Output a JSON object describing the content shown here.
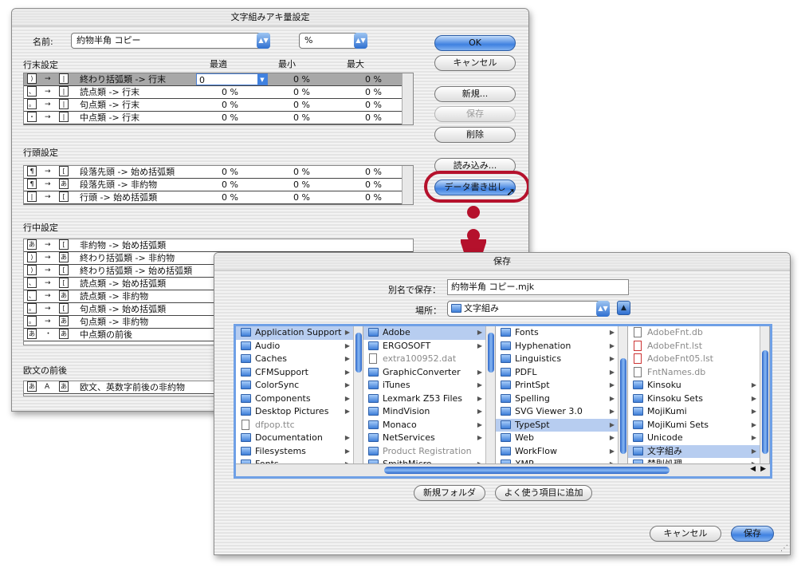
{
  "main_dialog": {
    "title": "文字組みアキ量設定",
    "name_label": "名前:",
    "name_value": "約物半角 コピー",
    "unit_value": "%",
    "ok_label": "OK",
    "cancel_label": "キャンセル",
    "new_label": "新規...",
    "save_label": "保存",
    "delete_label": "削除",
    "import_label": "読み込み...",
    "export_label": "データ書き出し",
    "col_headers": [
      "最適",
      "最小",
      "最大"
    ],
    "sections": [
      {
        "title": "行末設定",
        "rows": [
          {
            "icons": [
              "⟩",
              "→",
              "|"
            ],
            "label": "終わり括弧類 -> 行末",
            "opt": "0",
            "min": "0 %",
            "max": "0 %"
          },
          {
            "icons": [
              "、",
              "→",
              "|"
            ],
            "label": "読点類 -> 行末",
            "opt": "0 %",
            "min": "0 %",
            "max": "0 %"
          },
          {
            "icons": [
              "。",
              "→",
              "|"
            ],
            "label": "句点類 -> 行末",
            "opt": "0 %",
            "min": "0 %",
            "max": "0 %"
          },
          {
            "icons": [
              "・",
              "→",
              "|"
            ],
            "label": "中点類 -> 行末",
            "opt": "0 %",
            "min": "0 %",
            "max": "0 %"
          }
        ]
      },
      {
        "title": "行頭設定",
        "rows": [
          {
            "icons": [
              "¶",
              "→",
              "["
            ],
            "label": "段落先頭 -> 始め括弧類",
            "opt": "0 %",
            "min": "0 %",
            "max": "0 %"
          },
          {
            "icons": [
              "¶",
              "→",
              "あ"
            ],
            "label": "段落先頭 -> 非約物",
            "opt": "0 %",
            "min": "0 %",
            "max": "0 %"
          },
          {
            "icons": [
              "|",
              "→",
              "["
            ],
            "label": "行頭 -> 始め括弧類",
            "opt": "0 %",
            "min": "0 %",
            "max": "0 %"
          }
        ]
      },
      {
        "title": "行中設定",
        "rows": [
          {
            "icons": [
              "あ",
              "→",
              "["
            ],
            "label": "非約物 -> 始め括弧類"
          },
          {
            "icons": [
              "⟩",
              "→",
              "あ"
            ],
            "label": "終わり括弧類 -> 非約物"
          },
          {
            "icons": [
              "⟩",
              "→",
              "["
            ],
            "label": "終わり括弧類 -> 始め括弧類"
          },
          {
            "icons": [
              "、",
              "→",
              "["
            ],
            "label": "読点類 -> 始め括弧類"
          },
          {
            "icons": [
              "、",
              "→",
              "あ"
            ],
            "label": "読点類 -> 非約物"
          },
          {
            "icons": [
              "。",
              "→",
              "["
            ],
            "label": "句点類 -> 始め括弧類"
          },
          {
            "icons": [
              "。",
              "→",
              "あ"
            ],
            "label": "句点類 -> 非約物"
          },
          {
            "icons": [
              "あ",
              "・",
              "あ"
            ],
            "label": "中点類の前後"
          }
        ]
      },
      {
        "title": "欧文の前後",
        "rows": [
          {
            "icons": [
              "あ",
              "A",
              "あ"
            ],
            "label": "欧文、英数字前後の非約物"
          }
        ]
      }
    ]
  },
  "save_dialog": {
    "title": "保存",
    "saveas_label": "別名で保存：",
    "saveas_value": "約物半角 コピー.mjk",
    "where_label": "場所：",
    "where_value": "文字組み",
    "new_folder_label": "新規フォルダ",
    "add_fav_label": "よく使う項目に追加",
    "cancel_label": "キャンセル",
    "save_label": "保存",
    "columns": [
      [
        {
          "name": "Application Support",
          "kind": "folder",
          "sel": true,
          "arrow": true
        },
        {
          "name": "Audio",
          "kind": "folder",
          "arrow": true
        },
        {
          "name": "Caches",
          "kind": "folder",
          "arrow": true
        },
        {
          "name": "CFMSupport",
          "kind": "folder",
          "arrow": true
        },
        {
          "name": "ColorSync",
          "kind": "folder",
          "arrow": true
        },
        {
          "name": "Components",
          "kind": "folder",
          "arrow": true
        },
        {
          "name": "Desktop Pictures",
          "kind": "folder",
          "arrow": true
        },
        {
          "name": "dfpop.ttc",
          "kind": "doc",
          "dim": true
        },
        {
          "name": "Documentation",
          "kind": "folder",
          "arrow": true
        },
        {
          "name": "Filesystems",
          "kind": "folder",
          "arrow": true
        },
        {
          "name": "Fonts",
          "kind": "folder",
          "arrow": true
        }
      ],
      [
        {
          "name": "Adobe",
          "kind": "folder",
          "sel": true,
          "arrow": true
        },
        {
          "name": "ERGOSOFT",
          "kind": "folder",
          "arrow": true
        },
        {
          "name": "extra100952.dat",
          "kind": "doc",
          "dim": true
        },
        {
          "name": "GraphicConverter",
          "kind": "folder",
          "arrow": true
        },
        {
          "name": "iTunes",
          "kind": "folder",
          "arrow": true
        },
        {
          "name": "Lexmark Z53 Files",
          "kind": "folder",
          "arrow": true
        },
        {
          "name": "MindVision",
          "kind": "folder",
          "arrow": true
        },
        {
          "name": "Monaco",
          "kind": "folder",
          "arrow": true
        },
        {
          "name": "NetServices",
          "kind": "folder",
          "arrow": true
        },
        {
          "name": "Product Registration",
          "kind": "folder",
          "dim": true
        },
        {
          "name": "SmithMicro",
          "kind": "folder",
          "arrow": true
        }
      ],
      [
        {
          "name": "Fonts",
          "kind": "folder",
          "arrow": true
        },
        {
          "name": "Hyphenation",
          "kind": "folder",
          "arrow": true
        },
        {
          "name": "Linguistics",
          "kind": "folder",
          "arrow": true
        },
        {
          "name": "PDFL",
          "kind": "folder",
          "arrow": true
        },
        {
          "name": "PrintSpt",
          "kind": "folder",
          "arrow": true
        },
        {
          "name": "Spelling",
          "kind": "folder",
          "arrow": true
        },
        {
          "name": "SVG Viewer 3.0",
          "kind": "folder",
          "arrow": true
        },
        {
          "name": "TypeSpt",
          "kind": "folder",
          "sel": true,
          "arrow": true
        },
        {
          "name": "Web",
          "kind": "folder",
          "arrow": true
        },
        {
          "name": "WorkFlow",
          "kind": "folder",
          "arrow": true
        },
        {
          "name": "XMP",
          "kind": "folder",
          "arrow": true
        }
      ],
      [
        {
          "name": "AdobeFnt.db",
          "kind": "doc",
          "dim": true
        },
        {
          "name": "AdobeFnt.lst",
          "kind": "pdf",
          "dim": true
        },
        {
          "name": "AdobeFnt05.lst",
          "kind": "pdf",
          "dim": true
        },
        {
          "name": "FntNames.db",
          "kind": "doc",
          "dim": true
        },
        {
          "name": "Kinsoku",
          "kind": "folder",
          "arrow": true
        },
        {
          "name": "Kinsoku Sets",
          "kind": "folder",
          "arrow": true
        },
        {
          "name": "MojiKumi",
          "kind": "folder",
          "arrow": true
        },
        {
          "name": "MojiKumi Sets",
          "kind": "folder",
          "arrow": true
        },
        {
          "name": "Unicode",
          "kind": "folder",
          "arrow": true
        },
        {
          "name": "文字組み",
          "kind": "folder",
          "sel": true,
          "arrow": true
        },
        {
          "name": "禁則処理",
          "kind": "folder",
          "arrow": true
        }
      ]
    ]
  },
  "colors": {
    "highlight_ring": "#b5112c",
    "aqua_blue": "#3f81e0"
  }
}
